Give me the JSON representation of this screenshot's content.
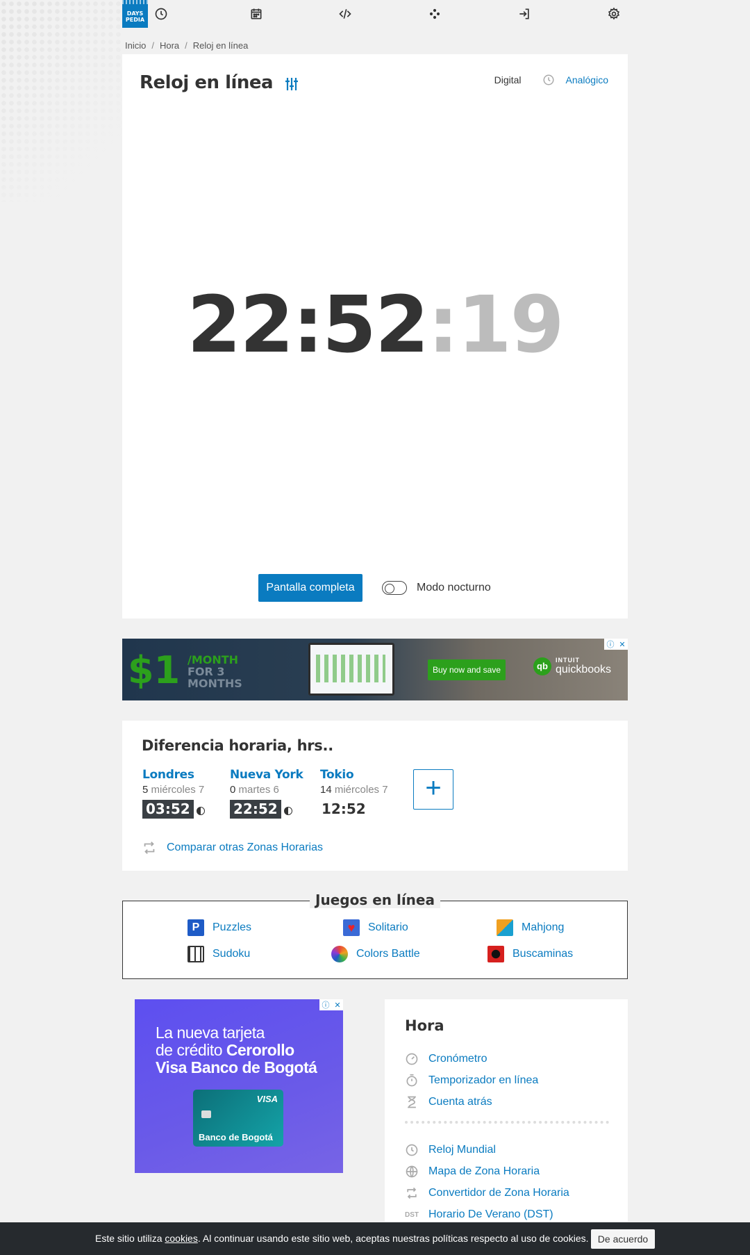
{
  "nav": {
    "logo_line1": "DAYS",
    "logo_line2": "PEDIA",
    "icons": [
      "clock-icon",
      "calendar-icon",
      "code-icon",
      "games-icon",
      "login-icon",
      "gear-icon"
    ]
  },
  "breadcrumb": [
    "Inicio",
    "Hora",
    "Reloj en línea"
  ],
  "clock_card": {
    "title": "Reloj en línea",
    "mode_digital": "Digital",
    "mode_analog": "Analógico",
    "time_hm": "22:52",
    "time_sec": ":19",
    "fullscreen_label": "Pantalla completa",
    "night_mode_label": "Modo nocturno",
    "night_mode_on": false
  },
  "ad_top": {
    "price": "$1",
    "per": "/MONTH",
    "duration": "FOR 3 MONTHS",
    "cta": "Buy now and save",
    "brand_small": "INTUIT",
    "brand": "quickbooks",
    "brand_mark": "qb"
  },
  "time_diff": {
    "title": "Diferencia horaria, hrs..",
    "cities": [
      {
        "name": "Londres",
        "offset": "5",
        "date": "miércoles 7",
        "time": "03:52",
        "night": true
      },
      {
        "name": "Nueva York",
        "offset": "0",
        "date": "martes 6",
        "time": "22:52",
        "night": true
      },
      {
        "name": "Tokio",
        "offset": "14",
        "date": "miércoles 7",
        "time": "12:52",
        "night": false
      }
    ],
    "add_label": "+",
    "compare_label": "Comparar otras Zonas Horarias"
  },
  "games": {
    "title": "Juegos en línea",
    "items": [
      {
        "label": "Puzzles",
        "color": "#1e5bc6"
      },
      {
        "label": "Solitario",
        "color": "#3a6ad6"
      },
      {
        "label": "Mahjong",
        "color": "#f0a020"
      },
      {
        "label": "Sudoku",
        "color": "#333333"
      },
      {
        "label": "Colors Battle",
        "color": "#e8463a"
      },
      {
        "label": "Buscaminas",
        "color": "#d6201e"
      }
    ]
  },
  "ad_bottom": {
    "line1": "La nueva tarjeta",
    "line2a": "de crédito ",
    "line2b": "Cerorollo",
    "line3": "Visa Banco de Bogotá",
    "card_brand": "VISA",
    "card_bank": "Banco de Bogotá"
  },
  "sidebar": {
    "title": "Hora",
    "links_top": [
      "Cronómetro",
      "Temporizador en línea",
      "Cuenta atrás"
    ],
    "links_bottom": [
      "Reloj Mundial",
      "Mapa de Zona Horaria",
      "Convertidor de Zona Horaria",
      "Horario De Verano (DST)"
    ],
    "dst_abbr": "DST"
  },
  "cookie": {
    "before": "Este sitio utiliza ",
    "link": "cookies",
    "after": ". Al continuar usando este sitio web, aceptas nuestras políticas respecto al uso de cookies.",
    "accept": "De acuerdo"
  },
  "colors": {
    "accent": "#0a7bc0",
    "dark": "#333333",
    "seconds": "#bcbcbc"
  }
}
